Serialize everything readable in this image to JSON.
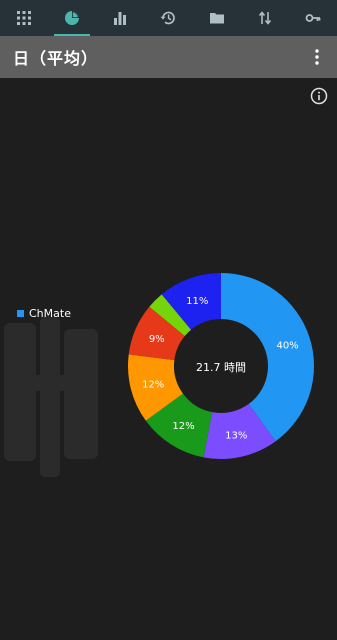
{
  "nav": {
    "tabs": [
      {
        "icon": "apps-grid-icon"
      },
      {
        "icon": "pie-chart-icon",
        "active": true
      },
      {
        "icon": "bar-chart-icon"
      },
      {
        "icon": "history-icon"
      },
      {
        "icon": "folder-icon"
      },
      {
        "icon": "swap-vertical-icon"
      },
      {
        "icon": "key-icon"
      }
    ],
    "active_color": "#4db6ac"
  },
  "appbar": {
    "title": "日（平均）"
  },
  "legend": {
    "items": [
      {
        "label": "ChMate",
        "color": "#2196f3"
      }
    ]
  },
  "center_label": "21.7 時間",
  "chart_data": {
    "type": "pie",
    "donut": true,
    "center_text": "21.7 時間",
    "slices": [
      {
        "label": "ChMate",
        "value": 40,
        "display": "40%",
        "color": "#2196f3"
      },
      {
        "label": "",
        "value": 13,
        "display": "13%",
        "color": "#7c4dff"
      },
      {
        "label": "",
        "value": 12,
        "display": "12%",
        "color": "#1a9a1a"
      },
      {
        "label": "",
        "value": 12,
        "display": "12%",
        "color": "#ff9800"
      },
      {
        "label": "",
        "value": 9,
        "display": "9%",
        "color": "#e53919"
      },
      {
        "label": "",
        "value": 3,
        "display": "",
        "color": "#76d40a"
      },
      {
        "label": "",
        "value": 11,
        "display": "11%",
        "color": "#1e22f0"
      }
    ]
  }
}
